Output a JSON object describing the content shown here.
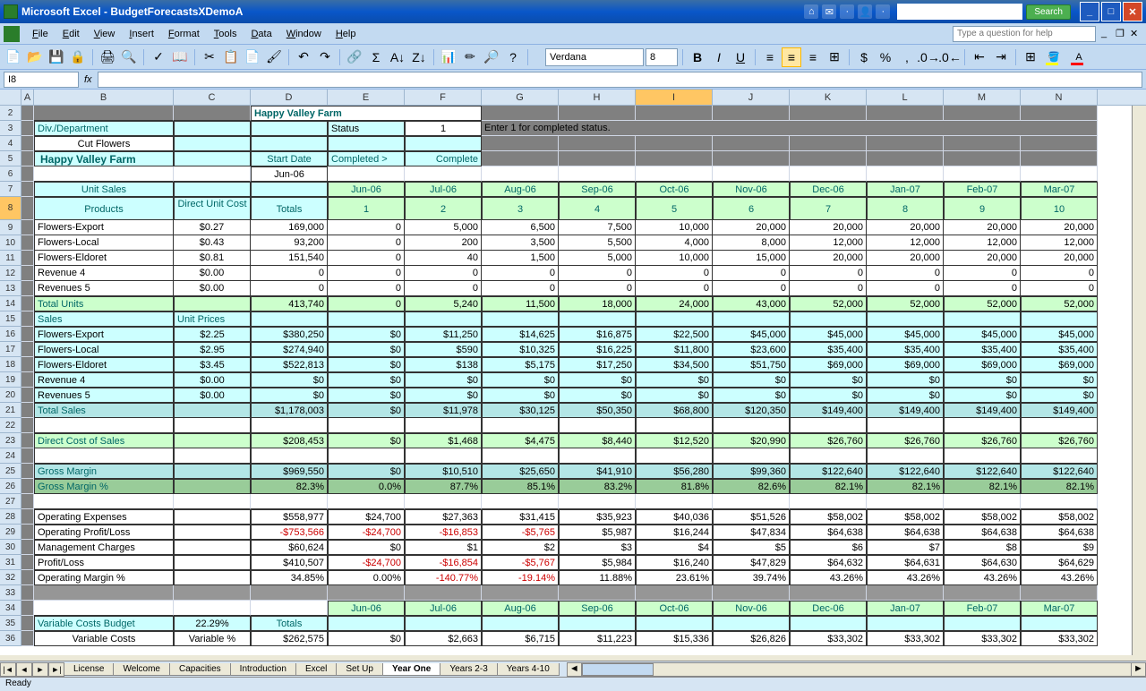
{
  "window": {
    "title": "Microsoft Excel - BudgetForecastsXDemoA"
  },
  "menu": {
    "items": [
      "File",
      "Edit",
      "View",
      "Insert",
      "Format",
      "Tools",
      "Data",
      "Window",
      "Help"
    ],
    "helpPlaceholder": "Type a question for help"
  },
  "toolbar": {
    "font": "Verdana",
    "size": "8"
  },
  "namebox": {
    "ref": "I8"
  },
  "searchBtn": "Search",
  "cols": [
    "A",
    "B",
    "C",
    "D",
    "E",
    "F",
    "G",
    "H",
    "I",
    "J",
    "K",
    "L",
    "M",
    "N"
  ],
  "rowNums": [
    2,
    3,
    4,
    5,
    6,
    7,
    8,
    9,
    10,
    11,
    12,
    13,
    14,
    15,
    16,
    17,
    18,
    19,
    20,
    21,
    22,
    23,
    24,
    25,
    26,
    27,
    28,
    29,
    30,
    31,
    32,
    33,
    34,
    35,
    36
  ],
  "header": {
    "company": "Happy Valley Farm",
    "divLabel": "Div./Department",
    "statusLabel": "Status",
    "statusVal": "1",
    "statusHint": "Enter 1 for completed status.",
    "dept": "Cut Flowers",
    "company2": "Happy Valley Farm",
    "startDate": "Start Date",
    "completedHdr": "Completed >",
    "complete": "Complete",
    "startMonth": "Jun-06"
  },
  "months": [
    "Jun-06",
    "Jul-06",
    "Aug-06",
    "Sep-06",
    "Oct-06",
    "Nov-06",
    "Dec-06",
    "Jan-07",
    "Feb-07",
    "Mar-07"
  ],
  "monthNums": [
    "1",
    "2",
    "3",
    "4",
    "5",
    "6",
    "7",
    "8",
    "9",
    "10"
  ],
  "labels": {
    "unitSales": "Unit Sales",
    "products": "Products",
    "duc": "Direct Unit Cost",
    "totals": "Totals",
    "totalUnits": "Total Units",
    "sales": "Sales",
    "unitPrices": "Unit Prices",
    "totalSales": "Total Sales",
    "dcos": "Direct Cost of Sales",
    "gm": "Gross Margin",
    "gmp": "Gross Margin %",
    "opex": "Operating Expenses",
    "opl": "Operating Profit/Loss",
    "mgmt": "Management Charges",
    "pl": "Profit/Loss",
    "opm": "Operating Margin %",
    "vcb": "Variable Costs Budget",
    "vc": "Variable Costs",
    "varPct": "Variable %"
  },
  "rows": {
    "r9": {
      "b": "Flowers-Export",
      "c": "$0.27",
      "d": "169,000",
      "v": [
        "0",
        "5,000",
        "6,500",
        "7,500",
        "10,000",
        "20,000",
        "20,000",
        "20,000",
        "20,000",
        "20,000"
      ]
    },
    "r10": {
      "b": "Flowers-Local",
      "c": "$0.43",
      "d": "93,200",
      "v": [
        "0",
        "200",
        "3,500",
        "5,500",
        "4,000",
        "8,000",
        "12,000",
        "12,000",
        "12,000",
        "12,000"
      ]
    },
    "r11": {
      "b": "Flowers-Eldoret",
      "c": "$0.81",
      "d": "151,540",
      "v": [
        "0",
        "40",
        "1,500",
        "5,000",
        "10,000",
        "15,000",
        "20,000",
        "20,000",
        "20,000",
        "20,000"
      ]
    },
    "r12": {
      "b": "Revenue 4",
      "c": "$0.00",
      "d": "0",
      "v": [
        "0",
        "0",
        "0",
        "0",
        "0",
        "0",
        "0",
        "0",
        "0",
        "0"
      ]
    },
    "r13": {
      "b": "Revenues 5",
      "c": "$0.00",
      "d": "0",
      "v": [
        "0",
        "0",
        "0",
        "0",
        "0",
        "0",
        "0",
        "0",
        "0",
        "0"
      ]
    },
    "r14": {
      "b": "Total Units",
      "d": "413,740",
      "v": [
        "0",
        "5,240",
        "11,500",
        "18,000",
        "24,000",
        "43,000",
        "52,000",
        "52,000",
        "52,000",
        "52,000"
      ]
    },
    "r16": {
      "b": "Flowers-Export",
      "c": "$2.25",
      "d": "$380,250",
      "v": [
        "$0",
        "$11,250",
        "$14,625",
        "$16,875",
        "$22,500",
        "$45,000",
        "$45,000",
        "$45,000",
        "$45,000",
        "$45,000"
      ]
    },
    "r17": {
      "b": "Flowers-Local",
      "c": "$2.95",
      "d": "$274,940",
      "v": [
        "$0",
        "$590",
        "$10,325",
        "$16,225",
        "$11,800",
        "$23,600",
        "$35,400",
        "$35,400",
        "$35,400",
        "$35,400"
      ]
    },
    "r18": {
      "b": "Flowers-Eldoret",
      "c": "$3.45",
      "d": "$522,813",
      "v": [
        "$0",
        "$138",
        "$5,175",
        "$17,250",
        "$34,500",
        "$51,750",
        "$69,000",
        "$69,000",
        "$69,000",
        "$69,000"
      ]
    },
    "r19": {
      "b": "Revenue 4",
      "c": "$0.00",
      "d": "$0",
      "v": [
        "$0",
        "$0",
        "$0",
        "$0",
        "$0",
        "$0",
        "$0",
        "$0",
        "$0",
        "$0"
      ]
    },
    "r20": {
      "b": "Revenues 5",
      "c": "$0.00",
      "d": "$0",
      "v": [
        "$0",
        "$0",
        "$0",
        "$0",
        "$0",
        "$0",
        "$0",
        "$0",
        "$0",
        "$0"
      ]
    },
    "r21": {
      "b": "Total Sales",
      "d": "$1,178,003",
      "v": [
        "$0",
        "$11,978",
        "$30,125",
        "$50,350",
        "$68,800",
        "$120,350",
        "$149,400",
        "$149,400",
        "$149,400",
        "$149,400"
      ]
    },
    "r23": {
      "b": "Direct Cost of Sales",
      "d": "$208,453",
      "v": [
        "$0",
        "$1,468",
        "$4,475",
        "$8,440",
        "$12,520",
        "$20,990",
        "$26,760",
        "$26,760",
        "$26,760",
        "$26,760"
      ]
    },
    "r25": {
      "b": "Gross Margin",
      "d": "$969,550",
      "v": [
        "$0",
        "$10,510",
        "$25,650",
        "$41,910",
        "$56,280",
        "$99,360",
        "$122,640",
        "$122,640",
        "$122,640",
        "$122,640"
      ]
    },
    "r26": {
      "b": "Gross Margin %",
      "d": "82.3%",
      "v": [
        "0.0%",
        "87.7%",
        "85.1%",
        "83.2%",
        "81.8%",
        "82.6%",
        "82.1%",
        "82.1%",
        "82.1%",
        "82.1%"
      ]
    },
    "r28": {
      "b": "Operating Expenses",
      "d": "$558,977",
      "v": [
        "$24,700",
        "$27,363",
        "$31,415",
        "$35,923",
        "$40,036",
        "$51,526",
        "$58,002",
        "$58,002",
        "$58,002",
        "$58,002"
      ]
    },
    "r29": {
      "b": "Operating Profit/Loss",
      "d": "-$753,566",
      "v": [
        "-$24,700",
        "-$16,853",
        "-$5,765",
        "$5,987",
        "$16,244",
        "$47,834",
        "$64,638",
        "$64,638",
        "$64,638",
        "$64,638"
      ],
      "neg": [
        1,
        1,
        1,
        1,
        0,
        0,
        0,
        0,
        0,
        0,
        0
      ]
    },
    "r30": {
      "b": "Management Charges",
      "d": "$60,624",
      "v": [
        "$0",
        "$1",
        "$2",
        "$3",
        "$4",
        "$5",
        "$6",
        "$7",
        "$8",
        "$9"
      ]
    },
    "r31": {
      "b": "Profit/Loss",
      "d": "$410,507",
      "v": [
        "-$24,700",
        "-$16,854",
        "-$5,767",
        "$5,984",
        "$16,240",
        "$47,829",
        "$64,632",
        "$64,631",
        "$64,630",
        "$64,629"
      ],
      "neg": [
        0,
        1,
        1,
        1,
        0,
        0,
        0,
        0,
        0,
        0,
        0
      ]
    },
    "r32": {
      "b": "Operating Margin %",
      "d": "34.85%",
      "v": [
        "0.00%",
        "-140.77%",
        "-19.14%",
        "11.88%",
        "23.61%",
        "39.74%",
        "43.26%",
        "43.26%",
        "43.26%",
        "43.26%"
      ],
      "neg": [
        0,
        0,
        1,
        1,
        0,
        0,
        0,
        0,
        0,
        0,
        0
      ]
    },
    "r35": {
      "b": "Variable Costs Budget",
      "c": "22.29%",
      "d": "Totals"
    },
    "r36": {
      "b": "Variable Costs",
      "c": "Variable %",
      "d": "$262,575",
      "v": [
        "$0",
        "$2,663",
        "$6,715",
        "$11,223",
        "$15,336",
        "$26,826",
        "$33,302",
        "$33,302",
        "$33,302",
        "$33,302"
      ]
    }
  },
  "tabs": [
    "License",
    "Welcome",
    "Capacities",
    "Introduction",
    "Excel",
    "Set Up",
    "Year One",
    "Years 2-3",
    "Years 4-10"
  ],
  "activeTab": "Year One",
  "status": "Ready"
}
